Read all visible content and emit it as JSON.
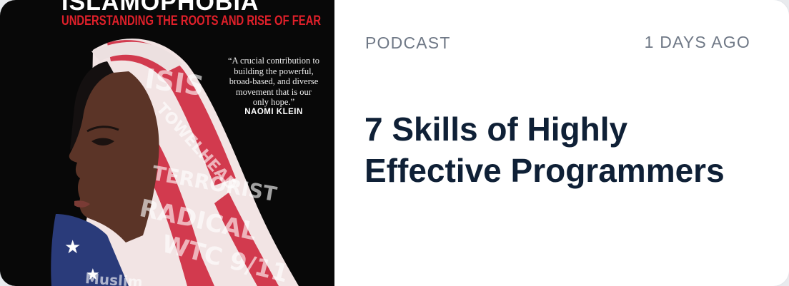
{
  "cover": {
    "title": "ISLAMOPHOBIA",
    "subtitle": "UNDERSTANDING THE ROOTS AND RISE OF FEAR",
    "quote": "“A crucial contribution to building the powerful, broad-based, and diverse movement that is our only hope.”",
    "quote_author": "NAOMI KLEIN",
    "scrawled_words": [
      "ISIS",
      "TOWELHEAD",
      "TERRORIST",
      "RADICAL",
      "WTC 9/11",
      "Muslim"
    ]
  },
  "card": {
    "category": "PODCAST",
    "timestamp": "1 DAYS AGO",
    "title": "7 Skills of Highly Effective Programmers"
  },
  "colors": {
    "title_text": "#0f2036",
    "meta_text": "#6f7886",
    "card_bg": "#ffffff",
    "cover_accent_red": "#e0202a"
  }
}
